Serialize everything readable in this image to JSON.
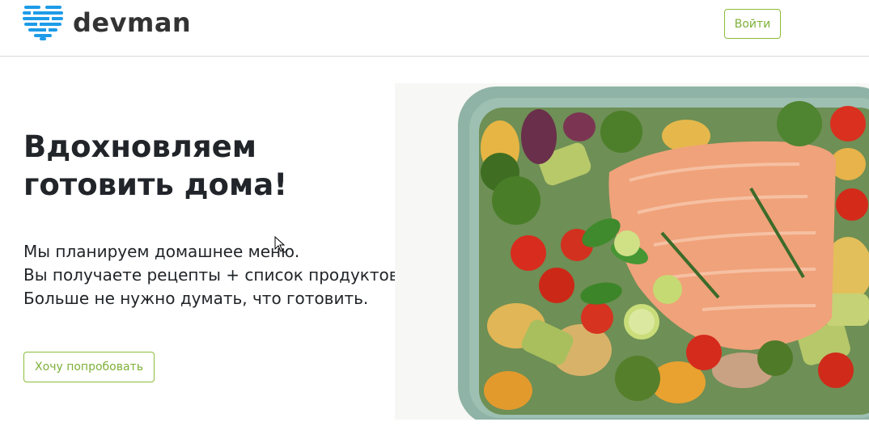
{
  "header": {
    "logo_text": "devman",
    "login_label": "Войти"
  },
  "hero": {
    "title": "Вдохновляем готовить дома!",
    "lines": [
      "Мы планируем домашнее меню.",
      "Вы получаете рецепты + список продуктов.",
      "Больше не нужно думать, что готовить."
    ],
    "cta_label": "Хочу попробовать"
  },
  "image": {
    "icon": "baked-salmon-vegetables-image"
  },
  "colors": {
    "accent": "#7eb039",
    "logo_blue": "#1e9be8",
    "text": "#212529",
    "divider": "#d9d9d9"
  }
}
